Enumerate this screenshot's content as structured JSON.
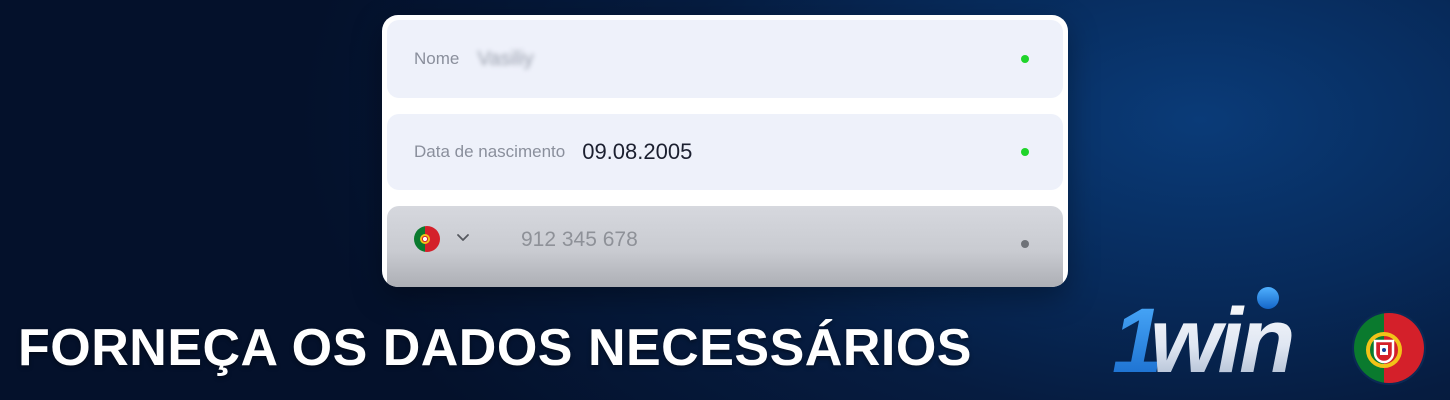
{
  "form": {
    "name_field": {
      "label": "Nome",
      "value": "Vasiliy"
    },
    "birthdate_field": {
      "label": "Data de nascimento",
      "value": "09.08.2005"
    },
    "phone_field": {
      "country": "Portugal",
      "placeholder": "912 345 678"
    }
  },
  "banner": {
    "headline": "FORNEÇA OS DADOS NECESSÁRIOS",
    "logo_text": "1win"
  },
  "colors": {
    "status_valid": "#1fd42a",
    "status_neutral": "#6f7278",
    "logo_blue": "#1f8ae8",
    "background_dark": "#04112b"
  },
  "icons": [
    "portugal-flag-icon",
    "chevron-down-icon",
    "status-dot-icon"
  ]
}
